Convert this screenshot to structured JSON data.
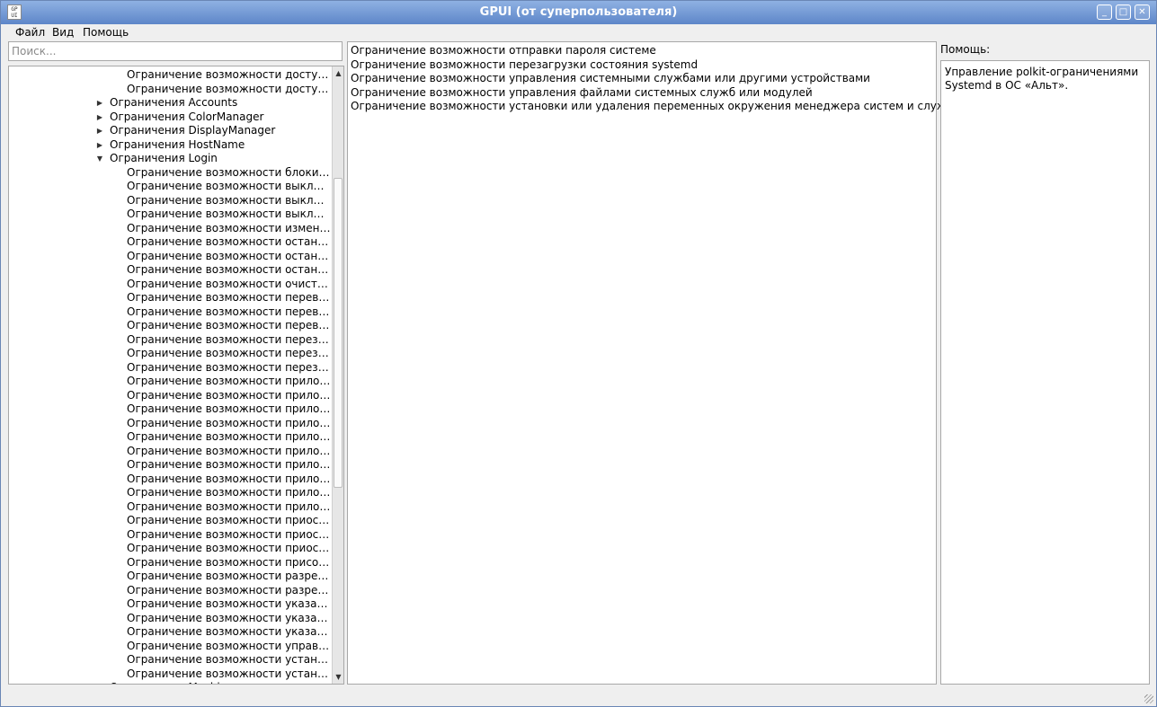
{
  "window": {
    "title": "GPUI (от суперпользователя)",
    "app_icon_text": "GP\nUI"
  },
  "window_buttons": {
    "minimize": "_",
    "maximize": "□",
    "close": "✕"
  },
  "menu": {
    "items": [
      "Файл",
      "Вид",
      "Помощь"
    ]
  },
  "search": {
    "placeholder": "Поиск..."
  },
  "tree": {
    "items": [
      {
        "label": "Ограничение возможности доступа к д...",
        "level": 2
      },
      {
        "label": "Ограничение возможности доступа к с...",
        "level": 2
      },
      {
        "label": "Ограничения Accounts",
        "level": 1,
        "expander": "collapsed"
      },
      {
        "label": "Ограничения ColorManager",
        "level": 1,
        "expander": "collapsed"
      },
      {
        "label": "Ограничения DisplayManager",
        "level": 1,
        "expander": "collapsed"
      },
      {
        "label": "Ограничения HostName",
        "level": 1,
        "expander": "collapsed"
      },
      {
        "label": "Ограничения Login",
        "level": 1,
        "expander": "expanded"
      },
      {
        "label": "Ограничение возможности блокировки...",
        "level": 2
      },
      {
        "label": "Ограничение возможности выключени...",
        "level": 2
      },
      {
        "label": "Ограничение возможности выключени...",
        "level": 2
      },
      {
        "label": "Ограничение возможности выключени...",
        "level": 2
      },
      {
        "label": "Ограничение возможности изменения ...",
        "level": 2
      },
      {
        "label": "Ограничение возможности остановки с...",
        "level": 2
      },
      {
        "label": "Ограничение возможности остановки с...",
        "level": 2
      },
      {
        "label": "Ограничение возможности остановки с...",
        "level": 2
      },
      {
        "label": "Ограничение возможности очистки уст...",
        "level": 2
      },
      {
        "label": "Ограничение возможности перевода с...",
        "level": 2
      },
      {
        "label": "Ограничение возможности перевода с...",
        "level": 2
      },
      {
        "label": "Ограничение возможности перевода с...",
        "level": 2
      },
      {
        "label": "Ограничение возможности перезагрузк...",
        "level": 2
      },
      {
        "label": "Ограничение возможности перезагрузк...",
        "level": 2
      },
      {
        "label": "Ограничение возможности перезагрузк...",
        "level": 2
      },
      {
        "label": "Ограничение возможности приложени...",
        "level": 2
      },
      {
        "label": "Ограничение возможности приложени...",
        "level": 2
      },
      {
        "label": "Ограничение возможности приложени...",
        "level": 2
      },
      {
        "label": "Ограничение возможности приложени...",
        "level": 2
      },
      {
        "label": "Ограничение возможности приложени...",
        "level": 2
      },
      {
        "label": "Ограничение возможности приложени...",
        "level": 2
      },
      {
        "label": "Ограничение возможности приложени...",
        "level": 2
      },
      {
        "label": "Ограничение возможности приложени...",
        "level": 2
      },
      {
        "label": "Ограничение возможности приложени...",
        "level": 2
      },
      {
        "label": "Ограничение возможности приложени...",
        "level": 2
      },
      {
        "label": "Ограничение возможности приостанов...",
        "level": 2
      },
      {
        "label": "Ограничение возможности приостанов...",
        "level": 2
      },
      {
        "label": "Ограничение возможности приостанов...",
        "level": 2
      },
      {
        "label": "Ограничение возможности присоедин...",
        "level": 2
      },
      {
        "label": "Ограничение возможности разрешени...",
        "level": 2
      },
      {
        "label": "Ограничение возможности разрешени...",
        "level": 2
      },
      {
        "label": "Ограничение возможности указания за...",
        "level": 2
      },
      {
        "label": "Ограничение возможности указания за...",
        "level": 2
      },
      {
        "label": "Ограничение возможности указания м...",
        "level": 2
      },
      {
        "label": "Ограничение возможности управления...",
        "level": 2
      },
      {
        "label": "Ограничение возможности установки «...",
        "level": 2
      },
      {
        "label": "Ограничение возможности установки с...",
        "level": 2
      },
      {
        "label": "Ограничения Machine",
        "level": 1,
        "expander": "collapsed"
      }
    ]
  },
  "content": {
    "items": [
      "Ограничение возможности отправки пароля системе",
      "Ограничение возможности перезагрузки состояния systemd",
      "Ограничение возможности управления системными службами или другими устройствами",
      "Ограничение возможности управления файлами системных служб или модулей",
      "Ограничение возможности установки или удаления переменных окружения менеджера систем и служб"
    ]
  },
  "help": {
    "label": "Помощь:",
    "text": "Управление polkit-ограничениями Systemd в ОС «Альт»."
  },
  "colors": {
    "titlebar_top": "#8fb1e3",
    "titlebar_bottom": "#5d86c9",
    "window_bg": "#efefef"
  }
}
